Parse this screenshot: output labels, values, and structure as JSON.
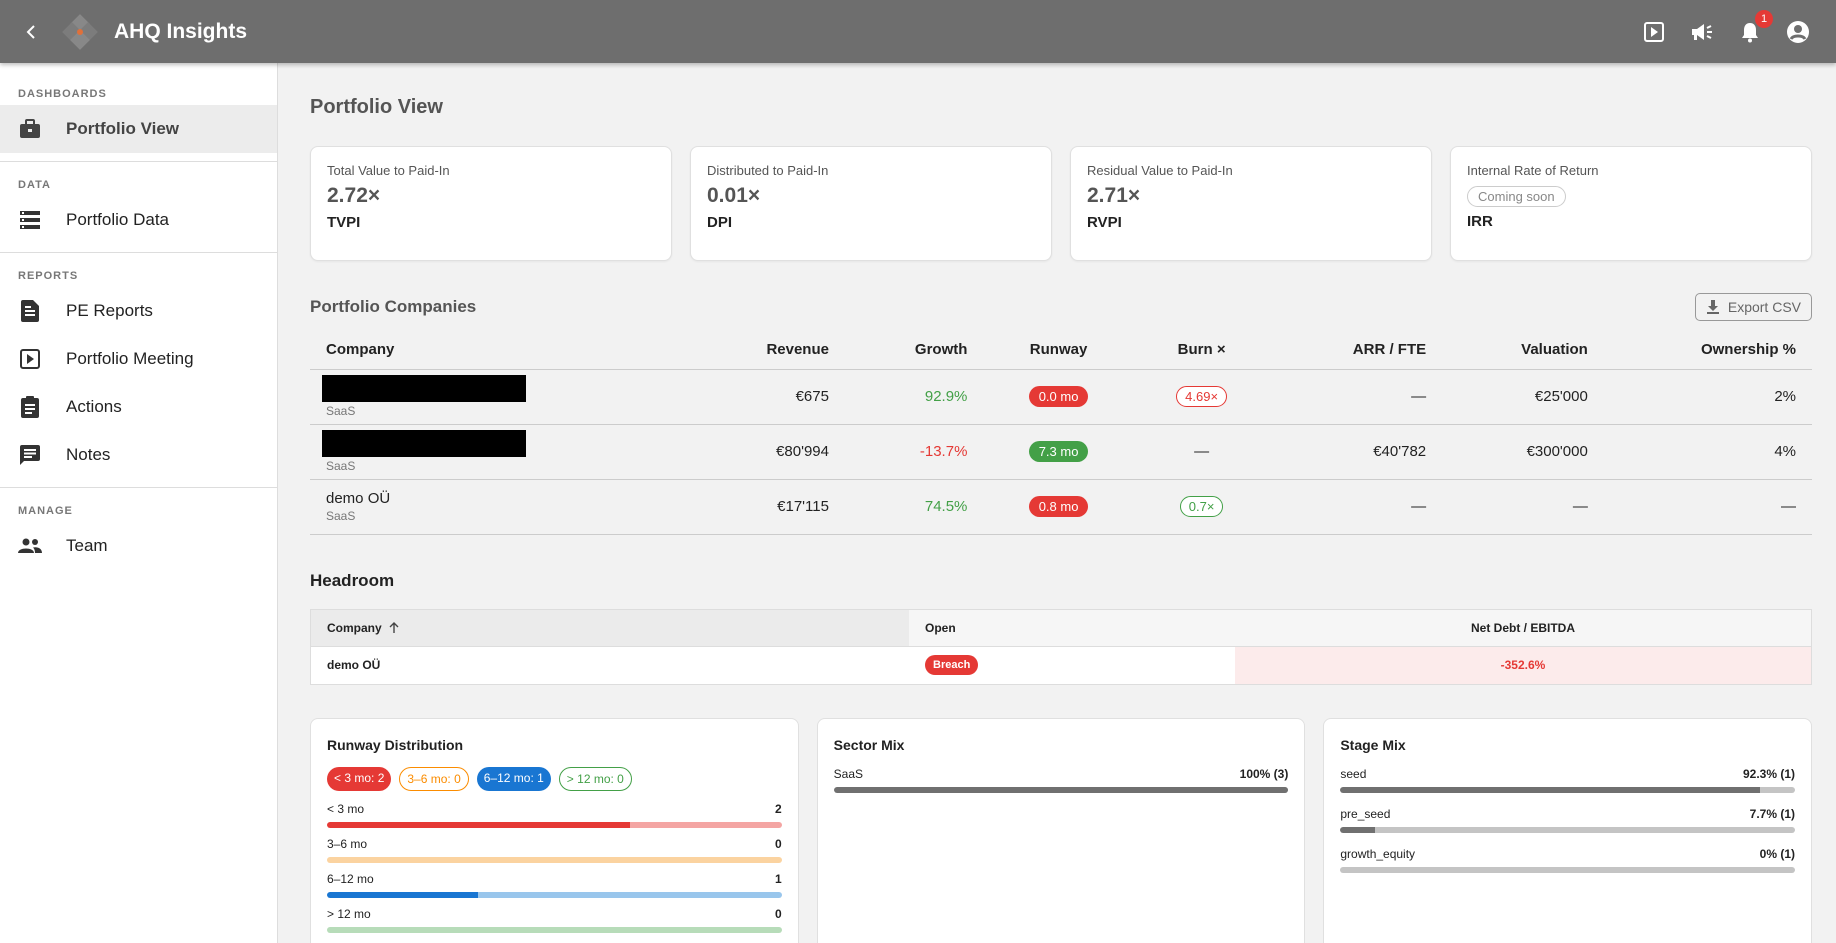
{
  "app": {
    "title": "AHQ Insights",
    "notifications_count": "1"
  },
  "sidebar": {
    "sections": [
      {
        "title": "DASHBOARDS",
        "items": [
          {
            "label": "Portfolio View",
            "icon": "briefcase-icon",
            "active": true
          }
        ]
      },
      {
        "title": "DATA",
        "items": [
          {
            "label": "Portfolio Data",
            "icon": "storage-icon"
          }
        ]
      },
      {
        "title": "REPORTS",
        "items": [
          {
            "label": "PE Reports",
            "icon": "report-icon"
          },
          {
            "label": "Portfolio Meeting",
            "icon": "slideshow-icon"
          },
          {
            "label": "Actions",
            "icon": "assignment-icon"
          },
          {
            "label": "Notes",
            "icon": "notes-icon"
          }
        ]
      },
      {
        "title": "MANAGE",
        "items": [
          {
            "label": "Team",
            "icon": "team-icon"
          }
        ]
      }
    ]
  },
  "page": {
    "title": "Portfolio View"
  },
  "kpis": [
    {
      "label": "Total Value to Paid-In",
      "value": "2.72×",
      "abbr": "TVPI"
    },
    {
      "label": "Distributed to Paid-In",
      "value": "0.01×",
      "abbr": "DPI"
    },
    {
      "label": "Residual Value to Paid-In",
      "value": "2.71×",
      "abbr": "RVPI"
    },
    {
      "label": "Internal Rate of Return",
      "chip": "Coming soon",
      "abbr": "IRR"
    }
  ],
  "companies": {
    "title": "Portfolio Companies",
    "export_label": "Export CSV",
    "columns": [
      "Company",
      "Revenue",
      "Growth",
      "Runway",
      "Burn ×",
      "ARR / FTE",
      "Valuation",
      "Ownership %"
    ],
    "rows": [
      {
        "name": "",
        "redacted": true,
        "sector": "SaaS",
        "revenue": "€675",
        "growth": "92.9%",
        "growth_sign": "pos",
        "runway": "0.0 mo",
        "runway_color": "red",
        "burn": "4.69×",
        "burn_color": "red",
        "arr_fte": "—",
        "valuation": "€25'000",
        "ownership": "2%"
      },
      {
        "name": "",
        "redacted": true,
        "sector": "SaaS",
        "revenue": "€80'994",
        "growth": "-13.7%",
        "growth_sign": "neg",
        "runway": "7.3 mo",
        "runway_color": "green",
        "burn": "—",
        "burn_color": "",
        "arr_fte": "€40'782",
        "valuation": "€300'000",
        "ownership": "4%"
      },
      {
        "name": "demo OÜ",
        "redacted": false,
        "sector": "SaaS",
        "revenue": "€17'115",
        "growth": "74.5%",
        "growth_sign": "pos",
        "runway": "0.8 mo",
        "runway_color": "red",
        "burn": "0.7×",
        "burn_color": "green",
        "arr_fte": "—",
        "valuation": "—",
        "ownership": "—"
      }
    ]
  },
  "headroom": {
    "title": "Headroom",
    "columns": [
      "Company",
      "Open",
      "Net Debt / EBITDA"
    ],
    "rows": [
      {
        "company": "demo OÜ",
        "status": "Breach",
        "value": "-352.6%"
      }
    ]
  },
  "runway_distribution": {
    "title": "Runway Distribution",
    "chips": [
      "< 3 mo: 2",
      "3–6 mo: 0",
      "6–12 mo: 1",
      "> 12 mo: 0"
    ],
    "bars": [
      {
        "label": "< 3 mo",
        "count": "2",
        "fraction": 0.667,
        "color": "#e53935",
        "track": "#f4a5a3"
      },
      {
        "label": "3–6 mo",
        "count": "0",
        "fraction": 0,
        "color": "#fb8c00",
        "track": "#fbd3a0"
      },
      {
        "label": "6–12 mo",
        "count": "1",
        "fraction": 0.333,
        "color": "#1976d2",
        "track": "#99c6ec"
      },
      {
        "label": "> 12 mo",
        "count": "0",
        "fraction": 0,
        "color": "#43a047",
        "track": "#b7dcb9"
      }
    ]
  },
  "sector_mix": {
    "title": "Sector Mix",
    "bars": [
      {
        "label": "SaaS",
        "value": "100% (3)",
        "fraction": 1.0
      }
    ]
  },
  "stage_mix": {
    "title": "Stage Mix",
    "bars": [
      {
        "label": "seed",
        "value": "92.3% (1)",
        "fraction": 0.923
      },
      {
        "label": "pre_seed",
        "value": "7.7% (1)",
        "fraction": 0.077
      },
      {
        "label": "growth_equity",
        "value": "0% (1)",
        "fraction": 0
      }
    ]
  }
}
